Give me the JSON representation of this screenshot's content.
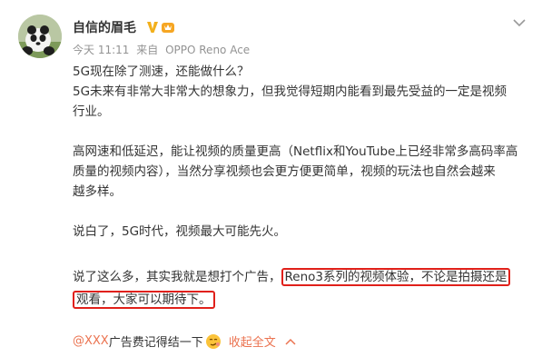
{
  "post": {
    "username": "自信的眉毛",
    "time": "今天 11:11",
    "via": "来自",
    "device": "OPPO Reno Ace",
    "paragraphs": [
      [
        "5G现在除了测速，还能做什么？",
        "5G未来有非常大非常大的想象力，但我觉得短期内能看到最先受益的一定是视频",
        "行业。"
      ],
      [
        "高网速和低延迟，能让视频的质量更高（Netflix和YouTube上已经非常多高码率高",
        "质量的视频内容），当然分享视频也会更方便更简单，视频的玩法也自然会越来",
        "越多样。"
      ],
      [
        "说白了，5G时代，视频最大可能先火。"
      ]
    ],
    "last_para": {
      "lead": "说了这么多，其实我就是想打个广告，",
      "highlight1": "Reno3系列的视频体验，不论是拍摄还是",
      "highlight2": "观看，大家可以期待下。"
    },
    "footer": {
      "mention": "@XXX",
      "text": " 广告费记得结一下",
      "collapse": "收起全文"
    }
  },
  "colors": {
    "accent": "#eb7350",
    "highlight_border": "#e0201a",
    "verified": "#f2b01c",
    "meta": "#939393"
  }
}
